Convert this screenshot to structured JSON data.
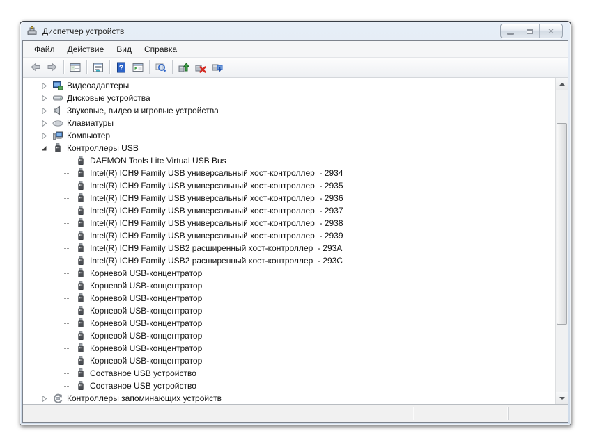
{
  "titlebar": {
    "title": "Диспетчер устройств",
    "buttons": [
      "minimize",
      "maximize",
      "close"
    ]
  },
  "menu": {
    "items": [
      {
        "label": "Файл"
      },
      {
        "label": "Действие"
      },
      {
        "label": "Вид"
      },
      {
        "label": "Справка"
      }
    ]
  },
  "toolbar": {
    "buttons": [
      "back-icon",
      "forward-icon",
      "show-console-tree-icon",
      "properties-icon",
      "help-icon",
      "standard-view-icon",
      "scan-hardware-icon",
      "update-driver-icon",
      "uninstall-device-icon",
      "update-hardware-config-icon"
    ]
  },
  "tree": {
    "rows": [
      {
        "label": "Видеоадаптеры",
        "level": 0,
        "icon": "video-adapter-icon",
        "expander": "collapsed"
      },
      {
        "label": "Дисковые устройства",
        "level": 0,
        "icon": "disk-drive-icon",
        "expander": "collapsed"
      },
      {
        "label": "Звуковые, видео и игровые устройства",
        "level": 0,
        "icon": "audio-icon",
        "expander": "collapsed"
      },
      {
        "label": "Клавиатуры",
        "level": 0,
        "icon": "keyboard-icon",
        "expander": "collapsed"
      },
      {
        "label": "Компьютер",
        "level": 0,
        "icon": "computer-icon",
        "expander": "collapsed"
      },
      {
        "label": "Контроллеры USB",
        "level": 0,
        "icon": "usb-icon",
        "expander": "expanded"
      },
      {
        "label": "DAEMON Tools Lite Virtual USB Bus",
        "level": 1,
        "icon": "usb-icon",
        "expander": null
      },
      {
        "label": "Intel(R) ICH9 Family USB универсальный хост-контроллер  - 2934",
        "level": 1,
        "icon": "usb-icon",
        "expander": null
      },
      {
        "label": "Intel(R) ICH9 Family USB универсальный хост-контроллер  - 2935",
        "level": 1,
        "icon": "usb-icon",
        "expander": null
      },
      {
        "label": "Intel(R) ICH9 Family USB универсальный хост-контроллер  - 2936",
        "level": 1,
        "icon": "usb-icon",
        "expander": null
      },
      {
        "label": "Intel(R) ICH9 Family USB универсальный хост-контроллер  - 2937",
        "level": 1,
        "icon": "usb-icon",
        "expander": null
      },
      {
        "label": "Intel(R) ICH9 Family USB универсальный хост-контроллер  - 2938",
        "level": 1,
        "icon": "usb-icon",
        "expander": null
      },
      {
        "label": "Intel(R) ICH9 Family USB универсальный хост-контроллер  - 2939",
        "level": 1,
        "icon": "usb-icon",
        "expander": null
      },
      {
        "label": "Intel(R) ICH9 Family USB2 расширенный хост-контроллер  - 293A",
        "level": 1,
        "icon": "usb-icon",
        "expander": null
      },
      {
        "label": "Intel(R) ICH9 Family USB2 расширенный хост-контроллер  - 293C",
        "level": 1,
        "icon": "usb-icon",
        "expander": null
      },
      {
        "label": "Корневой USB-концентратор",
        "level": 1,
        "icon": "usb-icon",
        "expander": null
      },
      {
        "label": "Корневой USB-концентратор",
        "level": 1,
        "icon": "usb-icon",
        "expander": null
      },
      {
        "label": "Корневой USB-концентратор",
        "level": 1,
        "icon": "usb-icon",
        "expander": null
      },
      {
        "label": "Корневой USB-концентратор",
        "level": 1,
        "icon": "usb-icon",
        "expander": null
      },
      {
        "label": "Корневой USB-концентратор",
        "level": 1,
        "icon": "usb-icon",
        "expander": null
      },
      {
        "label": "Корневой USB-концентратор",
        "level": 1,
        "icon": "usb-icon",
        "expander": null
      },
      {
        "label": "Корневой USB-концентратор",
        "level": 1,
        "icon": "usb-icon",
        "expander": null
      },
      {
        "label": "Корневой USB-концентратор",
        "level": 1,
        "icon": "usb-icon",
        "expander": null
      },
      {
        "label": "Составное USB устройство",
        "level": 1,
        "icon": "usb-icon",
        "expander": null
      },
      {
        "label": "Составное USB устройство",
        "level": 1,
        "icon": "usb-icon",
        "expander": null
      },
      {
        "label": "Контроллеры запоминающих устройств",
        "level": 0,
        "icon": "storage-controller-icon",
        "expander": "collapsed"
      }
    ]
  },
  "colors": {
    "titlebar": "#d9e3ef",
    "tree_background": "#ffffff",
    "help_icon_blue": "#2d64c8",
    "uninstall_red": "#d42a22",
    "update_green": "#3f9e46"
  }
}
